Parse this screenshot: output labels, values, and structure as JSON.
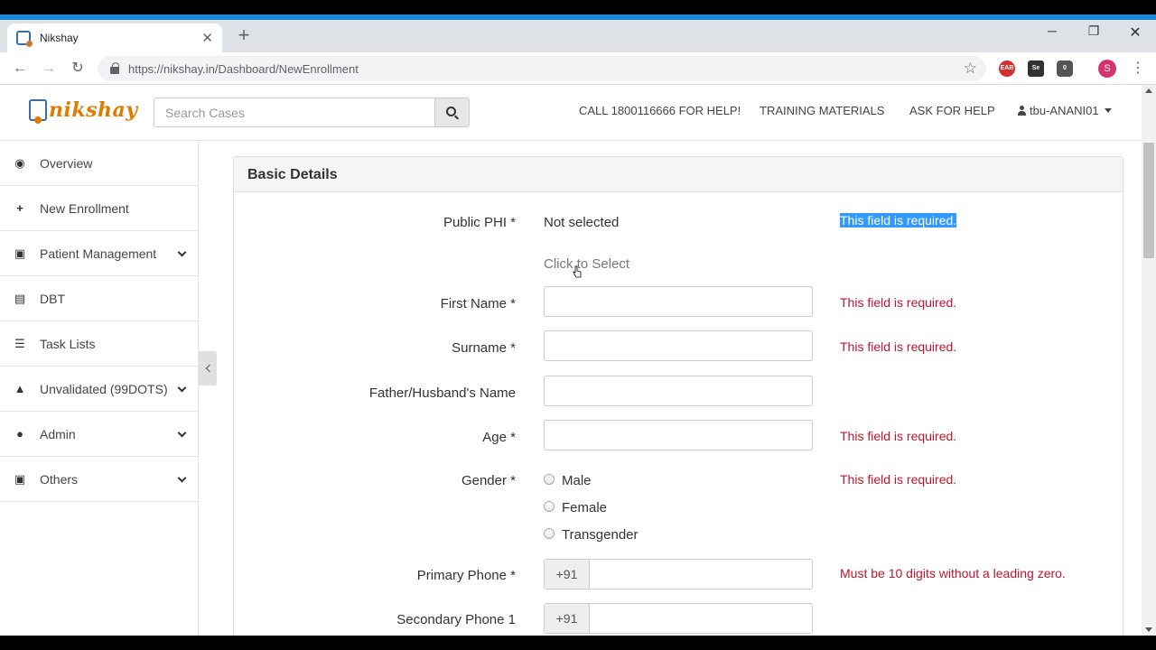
{
  "browser": {
    "tab_title": "Nikshay",
    "url": "https://nikshay.in/Dashboard/NewEnrollment",
    "profile_initial": "S",
    "ext_badge": "0"
  },
  "header": {
    "logo_text": "nikshay",
    "search_placeholder": "Search Cases",
    "links": {
      "call": "CALL 1800116666 FOR HELP!",
      "training": "TRAINING MATERIALS",
      "ask": "ASK FOR HELP",
      "user": "tbu-ANANI01"
    }
  },
  "sidebar": {
    "items": [
      {
        "label": "Overview",
        "icon": "dashboard-icon"
      },
      {
        "label": "New Enrollment",
        "icon": "plus-icon"
      },
      {
        "label": "Patient Management",
        "icon": "briefcase-icon"
      },
      {
        "label": "DBT",
        "icon": "money-icon"
      },
      {
        "label": "Task Lists",
        "icon": "list-icon"
      },
      {
        "label": "Unvalidated (99DOTS)",
        "icon": "warning-icon"
      },
      {
        "label": "Admin",
        "icon": "user-icon"
      },
      {
        "label": "Others",
        "icon": "briefcase-icon"
      }
    ]
  },
  "form": {
    "panel_title": "Basic Details",
    "public_phi": {
      "label": "Public PHI *",
      "value": "Not selected",
      "action": "Click to Select",
      "error": "This field is required."
    },
    "first_name": {
      "label": "First Name *",
      "error": "This field is required."
    },
    "surname": {
      "label": "Surname *",
      "error": "This field is required."
    },
    "father_name": {
      "label": "Father/Husband's Name"
    },
    "age": {
      "label": "Age *",
      "error": "This field is required."
    },
    "gender": {
      "label": "Gender *",
      "options": [
        "Male",
        "Female",
        "Transgender"
      ],
      "error": "This field is required."
    },
    "primary_phone": {
      "label": "Primary Phone *",
      "prefix": "+91",
      "error": "Must be 10 digits without a leading zero."
    },
    "secondary_phone": {
      "label": "Secondary Phone 1",
      "prefix": "+91"
    }
  },
  "colors": {
    "error": "#c0142f",
    "accent": "#1e88d8",
    "logo": "#e07b00"
  }
}
